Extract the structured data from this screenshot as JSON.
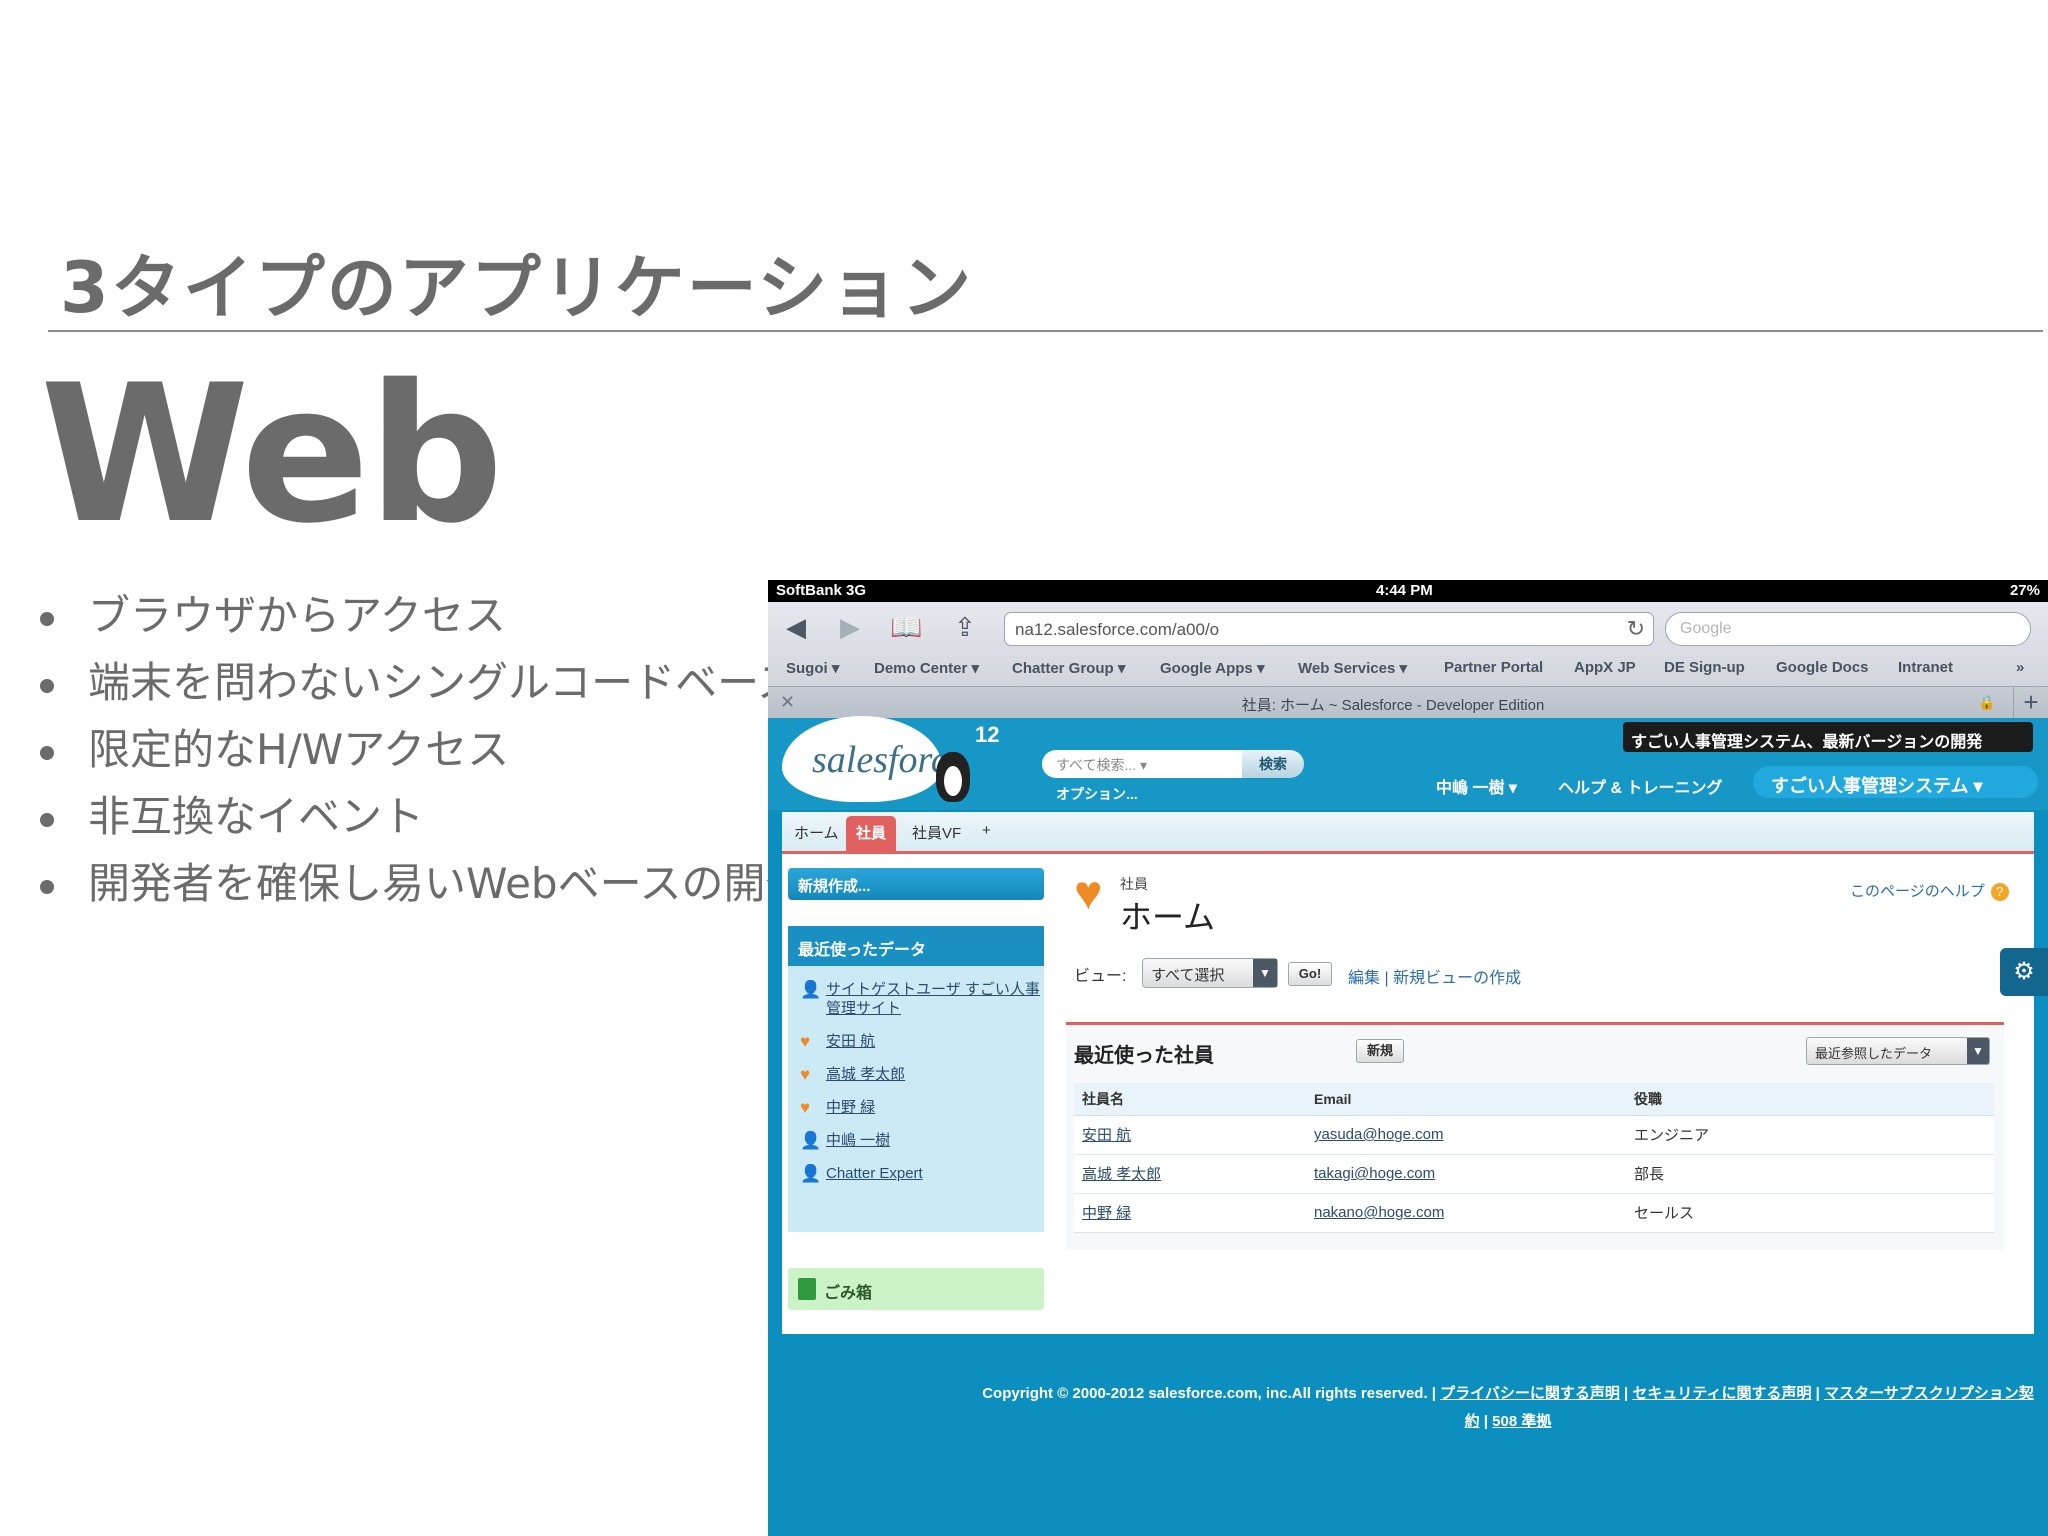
{
  "slide": {
    "heading": "3タイプのアプリケーション",
    "title": "Web",
    "bullets": [
      "ブラウザからアクセス",
      "端末を問わないシングルコードベース",
      "限定的なH/Wアクセス",
      "非互換なイベント",
      "開発者を確保し易いWebベースの開発"
    ]
  },
  "device": {
    "status_bar": {
      "carrier": "SoftBank 3G",
      "time": "4:44 PM",
      "battery": "27%"
    },
    "safari": {
      "url": "na12.salesforce.com/a00/o",
      "search_placeholder": "Google",
      "bookmarks": [
        "Sugoi ▾",
        "Demo Center ▾",
        "Chatter Group ▾",
        "Google Apps ▾",
        "Web Services ▾",
        "Partner Portal",
        "AppX JP",
        "DE Sign-up",
        "Google Docs",
        "Intranet",
        "»"
      ],
      "tab_title": "社員: ホーム ~ Salesforce - Developer Edition"
    },
    "salesforce": {
      "logo": "salesforce",
      "release": "12",
      "search_placeholder": "すべて検索... ▾",
      "search_button": "検索",
      "options_link": "オプション...",
      "banner": "すごい人事管理システム、最新バージョンの開発",
      "user_menu": "中嶋 一樹 ▾",
      "help_link": "ヘルプ & トレーニング",
      "app_menu": "すごい人事管理システム ▾",
      "tabs": [
        "ホーム",
        "社員",
        "社員VF",
        "+"
      ],
      "active_tab": "社員",
      "sidebar": {
        "new_button": "新規作成...",
        "recent_title": "最近使ったデータ",
        "recent_items": [
          {
            "icon": "user",
            "label": "サイトゲストユーザ すごい人事管理サイト"
          },
          {
            "icon": "heart",
            "label": "安田 航"
          },
          {
            "icon": "heart",
            "label": "高城 孝太郎"
          },
          {
            "icon": "heart",
            "label": "中野 緑"
          },
          {
            "icon": "user",
            "label": "中嶋 一樹"
          },
          {
            "icon": "user",
            "label": "Chatter Expert"
          }
        ],
        "trash": "ごみ箱"
      },
      "main": {
        "object_label": "社員",
        "page_title": "ホーム",
        "help_link": "このページのヘルプ",
        "view_label": "ビュー:",
        "view_value": "すべて選択",
        "go_button": "Go!",
        "edit_link": "編集",
        "new_view_link": "新規ビューの作成",
        "related_title": "最近使った社員",
        "related_new_button": "新規",
        "related_sort": "最近参照したデータ",
        "columns": [
          "社員名",
          "Email",
          "役職"
        ],
        "rows": [
          {
            "name": "安田 航",
            "email": "yasuda@hoge.com",
            "title": "エンジニア"
          },
          {
            "name": "高城 孝太郎",
            "email": "takagi@hoge.com",
            "title": "部長"
          },
          {
            "name": "中野 緑",
            "email": "nakano@hoge.com",
            "title": "セールス"
          }
        ]
      },
      "footer": {
        "copyright": "Copyright © 2000-2012 salesforce.com, inc.All rights reserved. |",
        "links": [
          "プライバシーに関する声明",
          "セキュリティに関する声明",
          "マスターサブスクリプション契約",
          "508 準拠"
        ]
      }
    }
  }
}
